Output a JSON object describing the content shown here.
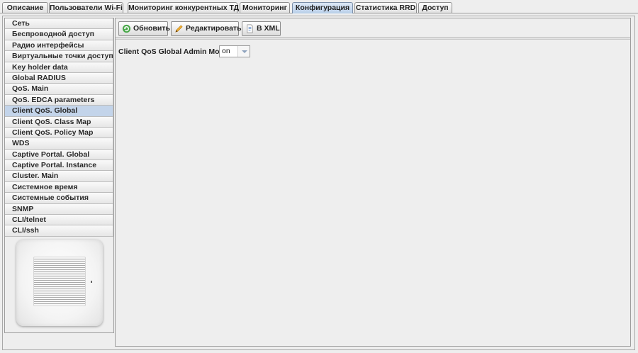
{
  "tabs": [
    {
      "label": "Описание"
    },
    {
      "label": "Пользователи Wi-Fi"
    },
    {
      "label": "Мониторинг конкурентных ТД"
    },
    {
      "label": "Мониторинг"
    },
    {
      "label": "Конфигурация",
      "active": true
    },
    {
      "label": "Статистика RRD"
    },
    {
      "label": "Доступ"
    }
  ],
  "sidebar": {
    "items": [
      {
        "label": "Сеть"
      },
      {
        "label": "Беспроводной доступ"
      },
      {
        "label": "Радио интерфейсы"
      },
      {
        "label": "Виртуальные точки доступа"
      },
      {
        "label": "Key holder data"
      },
      {
        "label": "Global RADIUS"
      },
      {
        "label": "QoS. Main"
      },
      {
        "label": "QoS. EDCA parameters"
      },
      {
        "label": "Client QoS. Global",
        "active": true
      },
      {
        "label": "Client QoS. Class Map"
      },
      {
        "label": "Client QoS. Policy Map"
      },
      {
        "label": "WDS"
      },
      {
        "label": "Captive Portal. Global"
      },
      {
        "label": "Captive Portal. Instance"
      },
      {
        "label": "Cluster. Main"
      },
      {
        "label": "Системное время"
      },
      {
        "label": "Системные события"
      },
      {
        "label": "SNMP"
      },
      {
        "label": "CLI/telnet"
      },
      {
        "label": "CLI/ssh"
      }
    ]
  },
  "toolbar": {
    "refresh_label": "Обновить",
    "refresh_icon": "refresh-icon",
    "edit_label": "Редактировать",
    "edit_icon": "pencil-icon",
    "xml_label": "В XML",
    "xml_icon": "document-icon"
  },
  "form": {
    "admin_mode_label": "Client QoS Global Admin Mode",
    "admin_mode_value": "on"
  },
  "colors": {
    "active_tab": "#b9cfe9",
    "active_sidebar": "#c3d4ea",
    "background": "#eeeeee"
  }
}
